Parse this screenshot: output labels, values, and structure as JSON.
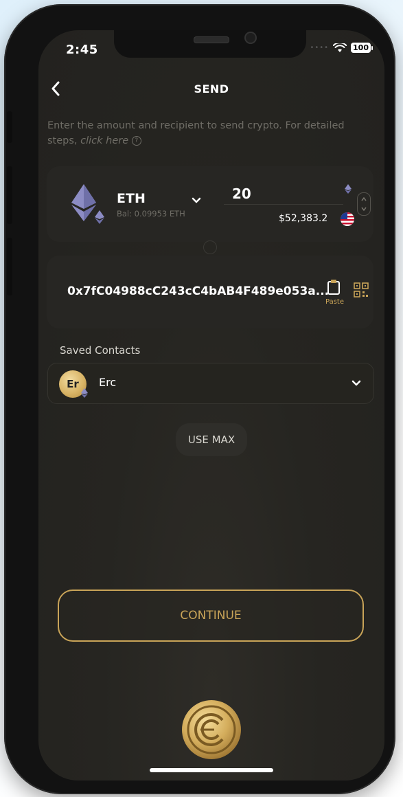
{
  "status_bar": {
    "time": "2:45",
    "battery": "100"
  },
  "header": {
    "title": "SEND"
  },
  "subtitle": {
    "text": "Enter the amount and recipient to send crypto. For detailed steps, ",
    "link": "click here"
  },
  "amount": {
    "coin_name": "ETH",
    "balance": "Bal: 0.09953 ETH",
    "value": "20",
    "fiat_value": "$52,383.2"
  },
  "recipient": {
    "address": "0x7fC04988cC243cC4bAB4F489e053a...",
    "paste_label": "Paste"
  },
  "contacts": {
    "label": "Saved Contacts",
    "selected": {
      "initials": "Er",
      "name": "Erc"
    }
  },
  "buttons": {
    "use_max": "USE MAX",
    "continue": "CONTINUE"
  },
  "colors": {
    "accent_gold": "#c9a458",
    "background": "#262521",
    "card": "#272623"
  }
}
